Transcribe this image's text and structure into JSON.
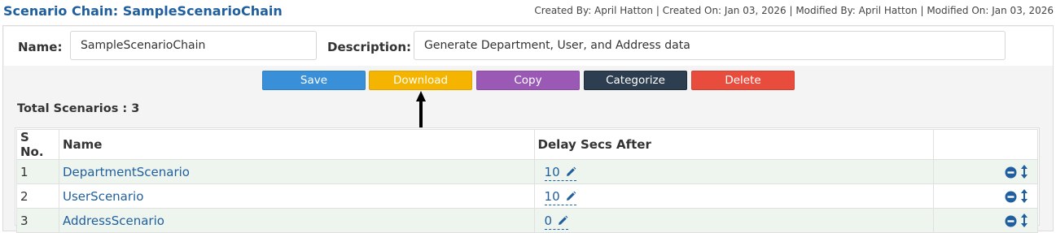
{
  "header": {
    "title": "Scenario Chain: SampleScenarioChain",
    "meta": "Created By: April Hatton | Created On: Jan 03, 2026 | Modified By: April Hatton | Modified On: Jan 03, 2026"
  },
  "form": {
    "name_label": "Name:",
    "name_value": "SampleScenarioChain",
    "description_label": "Description:",
    "description_value": "Generate Department, User, and Address data"
  },
  "toolbar": {
    "save_label": "Save",
    "download_label": "Download",
    "copy_label": "Copy",
    "categorize_label": "Categorize",
    "delete_label": "Delete"
  },
  "colors": {
    "save": "#3a8fd9",
    "download": "#f5b400",
    "copy": "#9b59b6",
    "categorize": "#2c3e50",
    "delete": "#e74c3c",
    "link": "#1f5f9e"
  },
  "summary": {
    "total_label": "Total Scenarios : 3"
  },
  "table": {
    "headers": {
      "sno": "S No.",
      "name": "Name",
      "delay": "Delay Secs After"
    },
    "rows": [
      {
        "sno": "1",
        "name": "DepartmentScenario",
        "delay": "10"
      },
      {
        "sno": "2",
        "name": "UserScenario",
        "delay": "10"
      },
      {
        "sno": "3",
        "name": "AddressScenario",
        "delay": "0"
      }
    ],
    "row_icons": [
      "remove-circle-icon",
      "reorder-vertical-icon"
    ],
    "edit_icon": "pencil-icon"
  }
}
